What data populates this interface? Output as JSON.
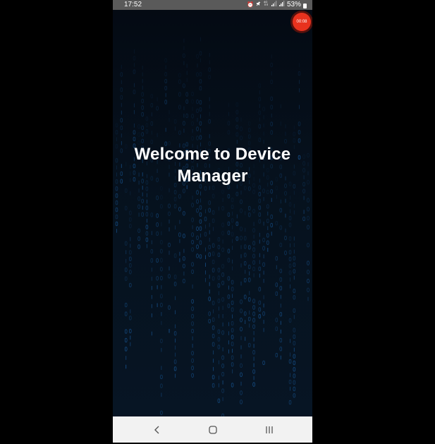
{
  "status_bar": {
    "time": "17:52",
    "battery_percent": "53%",
    "icons": [
      "alarm-icon",
      "mute-icon",
      "4g-icon",
      "signal-icon",
      "signal-icon",
      "battery-icon"
    ]
  },
  "screen_recorder": {
    "timer": "00:08",
    "color": "#e8321e"
  },
  "main": {
    "title": "Welcome to Device Manager",
    "background_theme": "binary-matrix-rain",
    "accent_color": "#1e6fc0"
  },
  "nav_bar": {
    "buttons": [
      "back-icon",
      "home-icon",
      "recents-icon"
    ]
  }
}
